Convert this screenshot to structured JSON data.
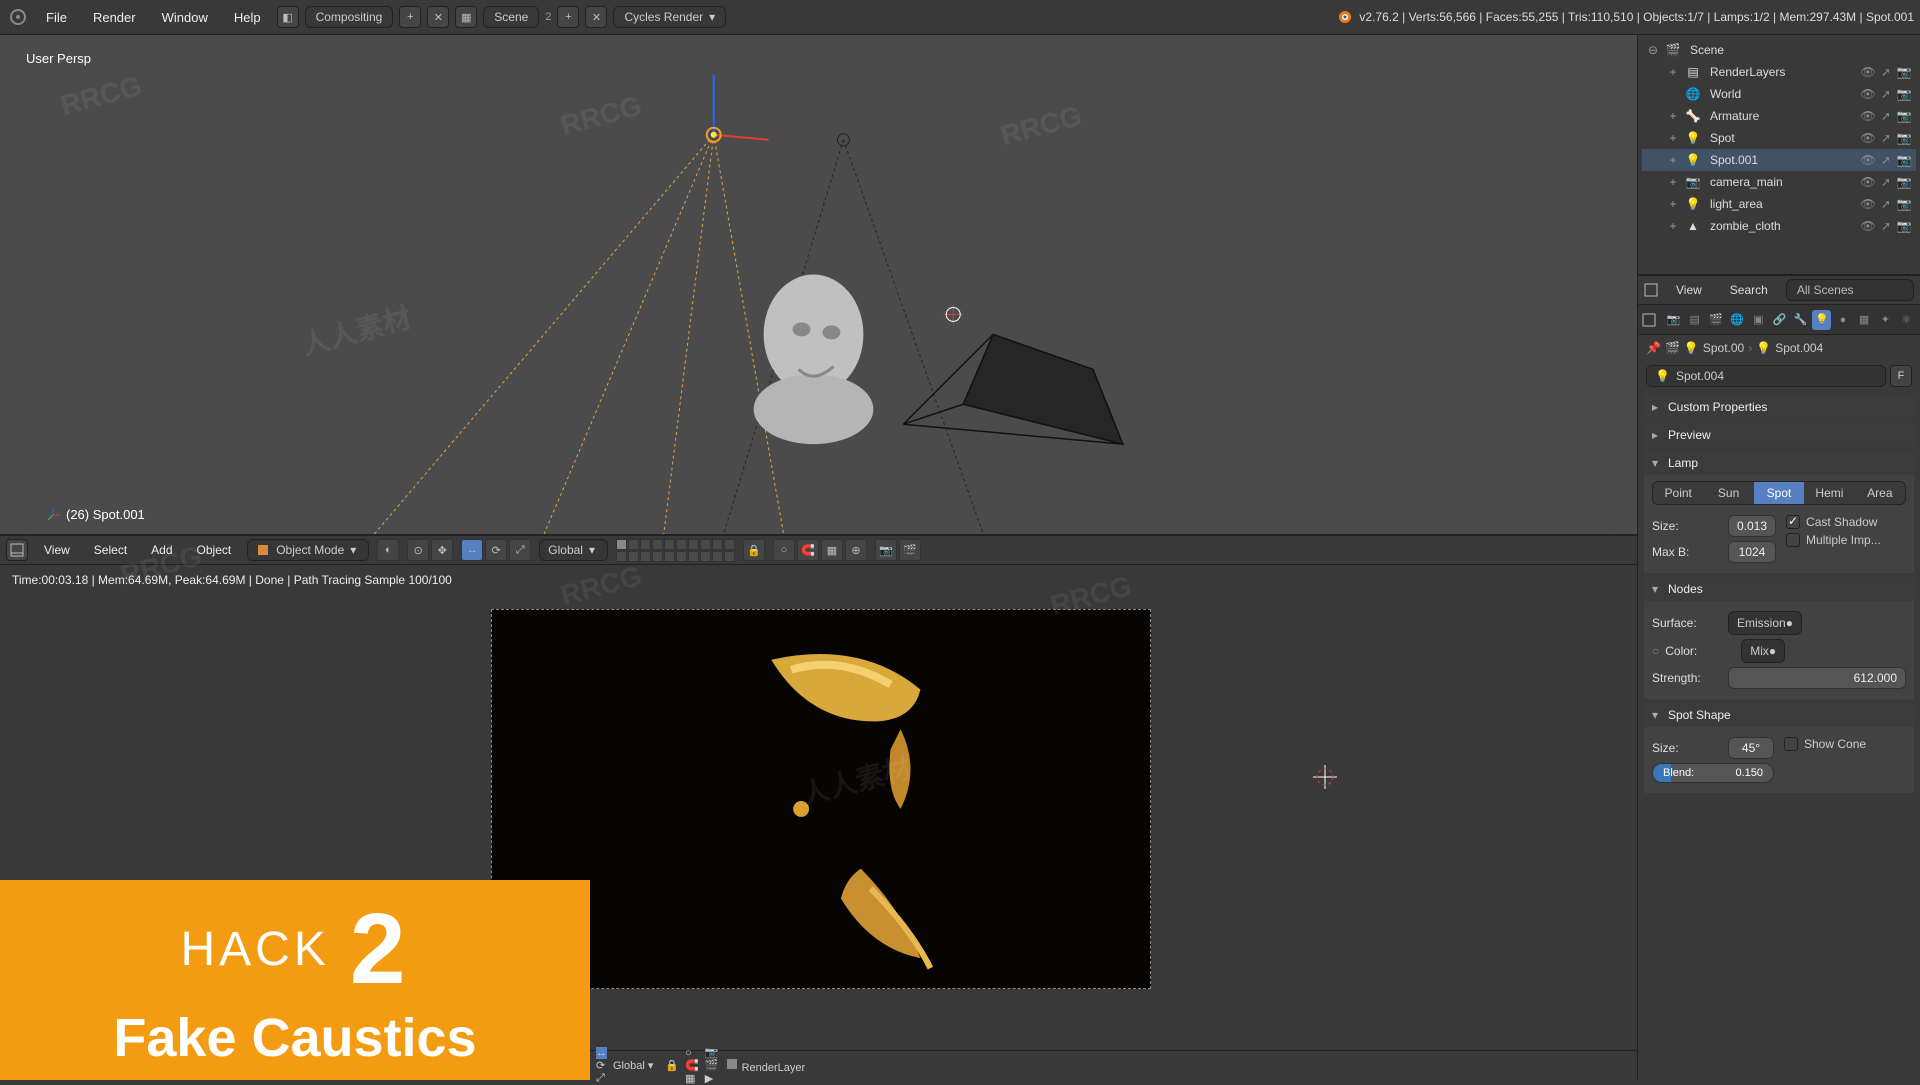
{
  "topbar": {
    "menus": [
      "File",
      "Render",
      "Window",
      "Help"
    ],
    "layout": "Compositing",
    "scene": "Scene",
    "scene_count": "2",
    "engine": "Cycles Render",
    "stats": "v2.76.2 | Verts:56,566 | Faces:55,255 | Tris:110,510 | Objects:1/7 | Lamps:1/2 | Mem:297.43M | Spot.001"
  },
  "viewport": {
    "persp": "User Persp",
    "active_object": "(26) Spot.001",
    "header": {
      "menus": [
        "View",
        "Select",
        "Add",
        "Object"
      ],
      "mode": "Object Mode",
      "orientation": "Global"
    }
  },
  "render": {
    "status": "Time:00:03.18 | Mem:64.69M, Peak:64.69M | Done | Path Tracing Sample 100/100",
    "header": {
      "orientation": "Global",
      "layer": "RenderLayer"
    }
  },
  "outliner": {
    "root": "Scene",
    "items": [
      {
        "name": "RenderLayers",
        "icon": "layers",
        "expand": "+",
        "indent": 1
      },
      {
        "name": "World",
        "icon": "world",
        "expand": "",
        "indent": 1
      },
      {
        "name": "Armature",
        "icon": "armature",
        "expand": "+",
        "indent": 1
      },
      {
        "name": "Spot",
        "icon": "lamp",
        "expand": "+",
        "indent": 1
      },
      {
        "name": "Spot.001",
        "icon": "lamp",
        "expand": "+",
        "indent": 1,
        "active": true
      },
      {
        "name": "camera_main",
        "icon": "camera",
        "expand": "+",
        "indent": 1
      },
      {
        "name": "light_area",
        "icon": "lamp",
        "expand": "+",
        "indent": 1
      },
      {
        "name": "zombie_cloth",
        "icon": "mesh",
        "expand": "+",
        "indent": 1
      }
    ],
    "footer": {
      "view": "View",
      "search": "Search",
      "filter": "All Scenes"
    }
  },
  "properties": {
    "breadcrumb": [
      "Spot.00",
      "Spot.004"
    ],
    "datablock": "Spot.004",
    "f_button": "F",
    "panels": {
      "custom_properties": "Custom Properties",
      "preview": "Preview",
      "lamp": "Lamp",
      "nodes": "Nodes",
      "spot_shape": "Spot Shape"
    },
    "lamp": {
      "types": [
        "Point",
        "Sun",
        "Spot",
        "Hemi",
        "Area"
      ],
      "active_type": "Spot",
      "size_label": "Size:",
      "size": "0.013",
      "maxb_label": "Max B:",
      "maxb": "1024",
      "cast_shadow": "Cast Shadow",
      "multiple_imp": "Multiple Imp..."
    },
    "nodes": {
      "surface_label": "Surface:",
      "surface": "Emission",
      "color_label": "Color:",
      "color": "Mix",
      "strength_label": "Strength:",
      "strength": "612.000"
    },
    "spot_shape": {
      "size_label": "Size:",
      "size": "45°",
      "show_cone": "Show Cone",
      "blend_label": "Blend:",
      "blend": "0.150"
    }
  },
  "overlay": {
    "hack_label": "HACK",
    "hack_num": "2",
    "hack_title": "Fake Caustics"
  }
}
